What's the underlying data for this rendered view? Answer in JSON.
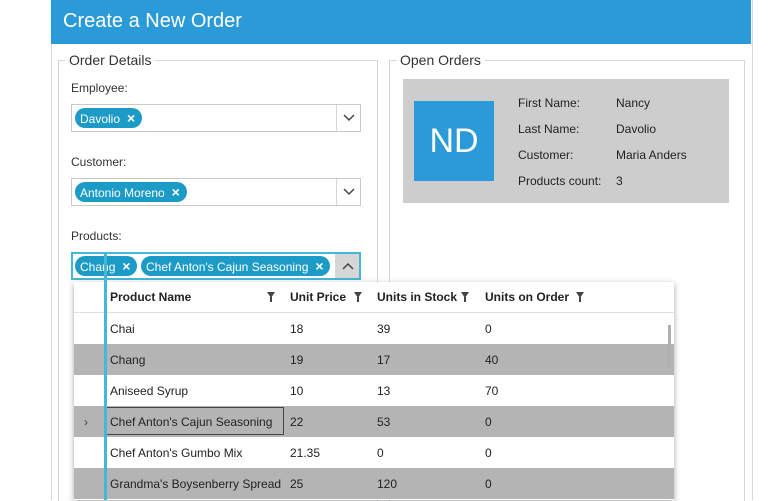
{
  "window": {
    "title": "Create a New Order"
  },
  "order_details": {
    "legend": "Order Details",
    "employee": {
      "label": "Employee:",
      "chips": [
        "Davolio"
      ]
    },
    "customer": {
      "label": "Customer:",
      "chips": [
        "Antonio Moreno"
      ]
    },
    "products": {
      "label": "Products:",
      "chips": [
        "Chang",
        "Chef Anton's Cajun Seasoning"
      ]
    }
  },
  "open_orders": {
    "legend": "Open Orders",
    "card": {
      "initials": "ND",
      "fields": [
        {
          "key": "First Name:",
          "value": "Nancy"
        },
        {
          "key": "Last Name:",
          "value": "Davolio"
        },
        {
          "key": "Customer:",
          "value": "Maria Anders"
        },
        {
          "key": "Products count:",
          "value": "3"
        }
      ]
    }
  },
  "product_grid": {
    "columns": [
      "Product Name",
      "Unit Price",
      "Units in Stock",
      "Units on Order"
    ],
    "rows": [
      [
        "Chai",
        "18",
        "39",
        "0"
      ],
      [
        "Chang",
        "19",
        "17",
        "40"
      ],
      [
        "Aniseed Syrup",
        "10",
        "13",
        "70"
      ],
      [
        "Chef Anton's Cajun Seasoning",
        "22",
        "53",
        "0"
      ],
      [
        "Chef Anton's Gumbo Mix",
        "21.35",
        "0",
        "0"
      ],
      [
        "Grandma's Boysenberry Spread",
        "25",
        "120",
        "0"
      ]
    ],
    "current_indicator": "›"
  },
  "icons": {
    "chip_remove": "×",
    "dropdown": "chevron-down-icon",
    "dropdown_open": "chevron-up-icon"
  },
  "colors": {
    "accent": "#2b9ad8",
    "chip": "#1c9bc6",
    "focus": "#45b7d8",
    "selected_row": "#b4b4b4"
  }
}
